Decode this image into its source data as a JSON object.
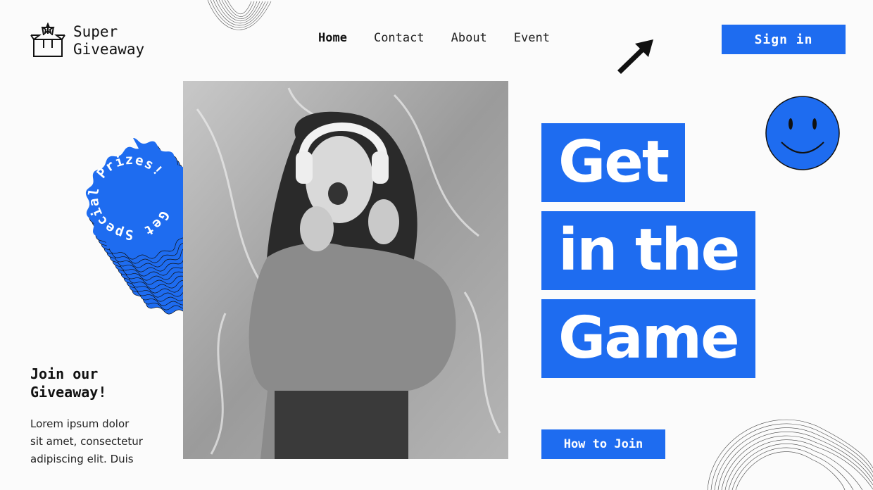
{
  "brand": {
    "line1": "Super",
    "line2": "Giveaway"
  },
  "nav": {
    "items": [
      "Home",
      "Contact",
      "About",
      "Event"
    ],
    "active": "Home"
  },
  "header": {
    "signin_label": "Sign in"
  },
  "badge": {
    "text": "Get Special Prizes!"
  },
  "hero": {
    "headline_lines": [
      "Get",
      "in the",
      "Game"
    ],
    "cta_label": "How to Join"
  },
  "join": {
    "title_line1": "Join our",
    "title_line2": "Giveaway!",
    "body_lines": [
      "Lorem ipsum dolor",
      "sit amet, consectetur",
      "adipiscing elit. Duis"
    ]
  },
  "icons": [
    "gift-box-icon",
    "cursor-arrow-icon",
    "smiley-face-icon"
  ],
  "colors": {
    "accent": "#1e6cf0",
    "background": "#fbfbfb",
    "text": "#111111"
  }
}
